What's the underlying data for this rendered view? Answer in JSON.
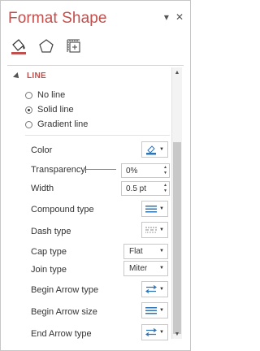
{
  "pane": {
    "title": "Format Shape",
    "tabs": [
      "fill-line-icon",
      "effects-pentagon-icon",
      "size-properties-icon"
    ]
  },
  "section": {
    "label": "LINE"
  },
  "radios": [
    {
      "label": "No line",
      "selected": false
    },
    {
      "label": "Solid line",
      "selected": true
    },
    {
      "label": "Gradient line",
      "selected": false
    }
  ],
  "props": {
    "color": "Color",
    "transparency": "Transparency",
    "transparency_value": "0%",
    "width": "Width",
    "width_value": "0.5 pt",
    "compound": "Compound type",
    "dash": "Dash type",
    "cap": "Cap type",
    "cap_value": "Flat",
    "join": "Join type",
    "join_value": "Miter",
    "begin_arrow_type": "Begin Arrow type",
    "begin_arrow_size": "Begin Arrow size",
    "end_arrow_type": "End Arrow type"
  },
  "colors": {
    "accent": "#c0504d",
    "icon_blue": "#2e75b6"
  }
}
